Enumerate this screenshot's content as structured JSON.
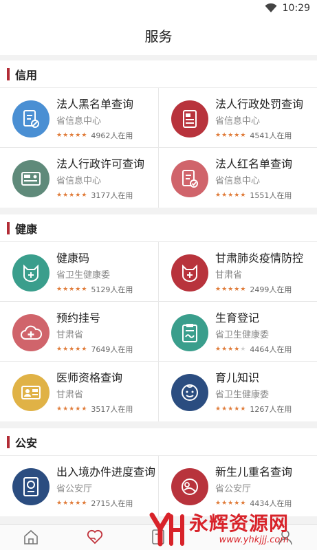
{
  "status": {
    "time": "10:29"
  },
  "header": {
    "title": "服务"
  },
  "sections": [
    {
      "title": "信用",
      "items": [
        {
          "title": "法人黑名单查询",
          "source": "省信息中心",
          "users": "4962人在用",
          "rating": 5,
          "icon": "blacklist-doc-icon",
          "color": "#4a8fd3"
        },
        {
          "title": "法人行政处罚查询",
          "source": "省信息中心",
          "users": "4541人在用",
          "rating": 5,
          "icon": "penalty-doc-icon",
          "color": "#b8333c"
        },
        {
          "title": "法人行政许可查询",
          "source": "省信息中心",
          "users": "3177人在用",
          "rating": 5,
          "icon": "license-card-icon",
          "color": "#5f8a7a"
        },
        {
          "title": "法人红名单查询",
          "source": "省信息中心",
          "users": "1551人在用",
          "rating": 5,
          "icon": "redlist-doc-icon",
          "color": "#d0646b"
        }
      ]
    },
    {
      "title": "健康",
      "items": [
        {
          "title": "健康码",
          "source": "省卫生健康委",
          "users": "5129人在用",
          "rating": 5,
          "icon": "health-code-icon",
          "color": "#3a9e8c"
        },
        {
          "title": "甘肃肺炎疫情防控",
          "source": "甘肃省",
          "users": "2499人在用",
          "rating": 5,
          "icon": "epidemic-icon",
          "color": "#b8333c"
        },
        {
          "title": "预约挂号",
          "source": "甘肃省",
          "users": "7649人在用",
          "rating": 5,
          "icon": "cloud-medical-icon",
          "color": "#d0646b"
        },
        {
          "title": "生育登记",
          "source": "省卫生健康委",
          "users": "4464人在用",
          "rating": 4,
          "icon": "clipboard-icon",
          "color": "#3a9e8c"
        },
        {
          "title": "医师资格查询",
          "source": "甘肃省",
          "users": "3517人在用",
          "rating": 5,
          "icon": "doctor-card-icon",
          "color": "#e0b246"
        },
        {
          "title": "育儿知识",
          "source": "省卫生健康委",
          "users": "1267人在用",
          "rating": 5,
          "icon": "baby-face-icon",
          "color": "#2b4d80"
        }
      ]
    },
    {
      "title": "公安",
      "items": [
        {
          "title": "出入境办件进度查询",
          "source": "省公安厅",
          "users": "2715人在用",
          "rating": 5,
          "icon": "passport-icon",
          "color": "#2b4d80"
        },
        {
          "title": "新生儿重名查询",
          "source": "省公安厅",
          "users": "4434人在用",
          "rating": 5,
          "icon": "newborn-icon",
          "color": "#b8333c"
        }
      ]
    }
  ],
  "tabs": [
    {
      "icon": "home-icon"
    },
    {
      "icon": "heart-hand-icon",
      "active": true
    },
    {
      "icon": "doc-icon"
    },
    {
      "icon": "person-icon"
    }
  ],
  "watermark": {
    "name": "永辉资源网",
    "url": "www.yhkjjj.com"
  }
}
